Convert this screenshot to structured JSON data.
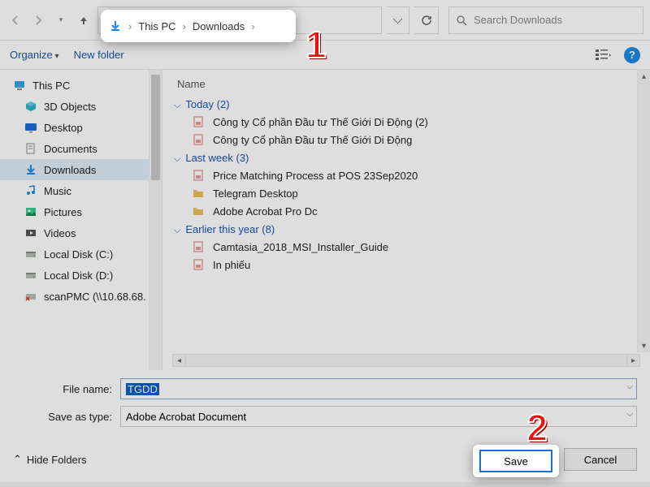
{
  "breadcrumb": {
    "root": "This PC",
    "folder": "Downloads"
  },
  "search": {
    "placeholder": "Search Downloads"
  },
  "toolbar": {
    "organize": "Organize",
    "new_folder": "New folder"
  },
  "help_glyph": "?",
  "columns": {
    "name": "Name"
  },
  "sidebar": {
    "items": [
      {
        "label": "This PC",
        "icon": "pc"
      },
      {
        "label": "3D Objects",
        "icon": "cube"
      },
      {
        "label": "Desktop",
        "icon": "desktop"
      },
      {
        "label": "Documents",
        "icon": "doc"
      },
      {
        "label": "Downloads",
        "icon": "down",
        "selected": true
      },
      {
        "label": "Music",
        "icon": "music"
      },
      {
        "label": "Pictures",
        "icon": "pic"
      },
      {
        "label": "Videos",
        "icon": "video"
      },
      {
        "label": "Local Disk (C:)",
        "icon": "disk"
      },
      {
        "label": "Local Disk (D:)",
        "icon": "disk"
      },
      {
        "label": "scanPMC (\\\\10.68.68.",
        "icon": "netdisk"
      }
    ]
  },
  "groups": [
    {
      "title": "Today (2)",
      "items": [
        {
          "label": "Công ty Cổ phần Đầu tư Thế Giới Di Động (2)",
          "icon": "pdf"
        },
        {
          "label": "Công ty Cổ phần Đầu tư Thế Giới Di Động",
          "icon": "pdf"
        }
      ]
    },
    {
      "title": "Last week (3)",
      "items": [
        {
          "label": "Price Matching Process at POS 23Sep2020",
          "icon": "pdf"
        },
        {
          "label": "Telegram Desktop",
          "icon": "folder"
        },
        {
          "label": "Adobe Acrobat Pro Dc",
          "icon": "folder"
        }
      ]
    },
    {
      "title": "Earlier this year (8)",
      "items": [
        {
          "label": "Camtasia_2018_MSI_Installer_Guide",
          "icon": "pdf"
        },
        {
          "label": "In phiếu",
          "icon": "pdf"
        }
      ]
    }
  ],
  "form": {
    "filename_label": "File name:",
    "filename_value": "TGDD",
    "type_label": "Save as type:",
    "type_value": "Adobe Acrobat Document"
  },
  "footer": {
    "hide_folders": "Hide Folders",
    "save": "Save",
    "cancel": "Cancel"
  },
  "callouts": {
    "one": "1",
    "two": "2"
  }
}
